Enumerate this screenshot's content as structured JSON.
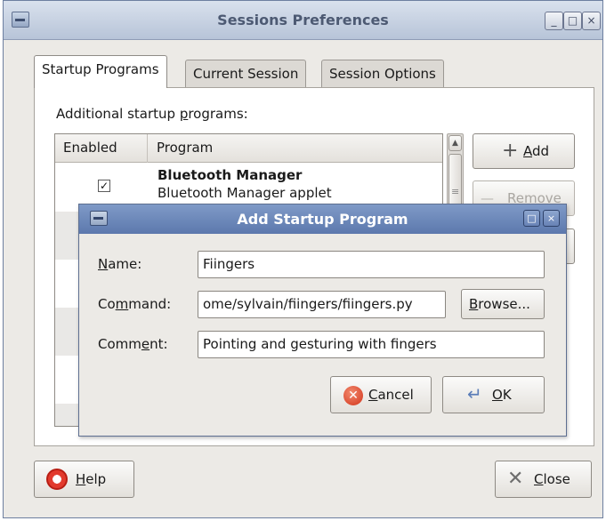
{
  "window": {
    "title": "Sessions Preferences",
    "minimize": "_",
    "maximize": "□",
    "close": "×"
  },
  "tabs": [
    {
      "label": "Startup Programs"
    },
    {
      "label": "Current Session"
    },
    {
      "label": "Session Options"
    }
  ],
  "startup": {
    "label_pre": "Additional startup ",
    "label_u": "p",
    "label_post": "rograms:",
    "columns": {
      "enabled": "Enabled",
      "program": "Program"
    },
    "rows": [
      {
        "checked": "✓",
        "name": "Bluetooth Manager",
        "description": "Bluetooth Manager applet"
      }
    ],
    "scroll_up": "▲",
    "add_u": "A",
    "add_rest": "dd",
    "add_icon": "+",
    "remove_label": "Remove",
    "remove_icon": "—"
  },
  "footer": {
    "help_u": "H",
    "help_rest": "elp",
    "close_u": "C",
    "close_rest": "lose",
    "close_icon": "✕"
  },
  "dialog": {
    "title": "Add Startup Program",
    "maximize": "□",
    "close": "×",
    "name_label_u": "N",
    "name_label_rest": "ame:",
    "command_label_pre": "Co",
    "command_label_u": "m",
    "command_label_post": "mand:",
    "comment_label_pre": "Comm",
    "comment_label_u": "e",
    "comment_label_post": "nt:",
    "name_value": "Fiingers",
    "command_value": "ome/sylvain/fiingers/fiingers.py",
    "comment_value": "Pointing and gesturing with fingers",
    "browse_u": "B",
    "browse_rest": "rowse...",
    "cancel_u": "C",
    "cancel_rest": "ancel",
    "cancel_icon": "✕",
    "ok_u": "O",
    "ok_rest": "K",
    "ok_icon": "↵"
  },
  "colors": {
    "titlebar": "#c5cfe0",
    "dialog_titlebar": "#6e89bb",
    "window_bg": "#eceae6"
  }
}
